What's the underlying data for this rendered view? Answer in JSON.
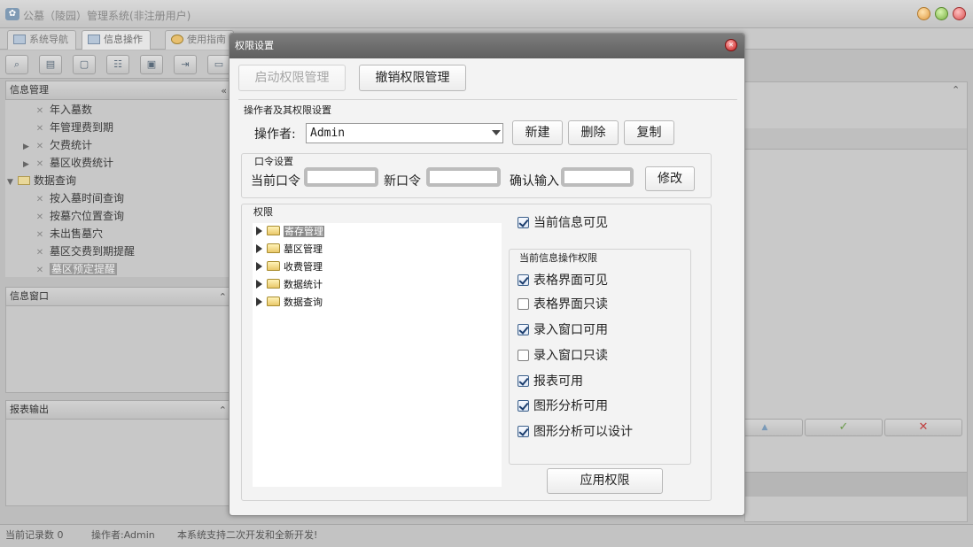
{
  "app": {
    "title": "公墓（陵园）管理系统(非注册用户)",
    "tabs": [
      {
        "label": "系统导航"
      },
      {
        "label": "信息操作"
      },
      {
        "label": "使用指南"
      }
    ]
  },
  "left_panel": {
    "header": "信息管理",
    "collapse_glyph": "«",
    "tree": [
      {
        "label": "年入墓数"
      },
      {
        "label": "年管理费到期"
      },
      {
        "label": "欠费统计"
      },
      {
        "label": "墓区收费统计"
      },
      {
        "label": "数据查询"
      },
      {
        "label": "按入墓时间查询"
      },
      {
        "label": "按墓穴位置查询"
      },
      {
        "label": "未出售墓穴"
      },
      {
        "label": "墓区交费到期提醒"
      },
      {
        "label": "墓区预定提醒"
      }
    ],
    "info_window_header": "信息窗口",
    "report_header": "报表输出",
    "expand_glyph": "⌃"
  },
  "right_area": {
    "up_glyph": "▲",
    "ok_glyph": "✓",
    "cancel_glyph": "✕"
  },
  "status": {
    "records": "当前记录数 0",
    "operator": "操作者:Admin",
    "notice": "本系统支持二次开发和全新开发!"
  },
  "dialog": {
    "title": "权限设置",
    "enable_button": "启动权限管理",
    "revoke_button": "撤销权限管理",
    "operator_group_label": "操作者及其权限设置",
    "operator_label": "操作者:",
    "operator_value": "Admin",
    "new_button": "新建",
    "delete_button": "删除",
    "copy_button": "复制",
    "password_group_label": "口令设置",
    "current_pwd_label": "当前口令",
    "new_pwd_label": "新口令",
    "confirm_pwd_label": "确认输入",
    "modify_button": "修改",
    "perm_group_label": "权限",
    "perm_tree": [
      {
        "label": "寄存管理",
        "selected": true
      },
      {
        "label": "墓区管理"
      },
      {
        "label": "收费管理"
      },
      {
        "label": "数据统计"
      },
      {
        "label": "数据查询"
      }
    ],
    "visible_checkbox": {
      "label": "当前信息可见",
      "checked": true
    },
    "ops_group_label": "当前信息操作权限",
    "ops": [
      {
        "label": "表格界面可见",
        "checked": true
      },
      {
        "label": "表格界面只读",
        "checked": false
      },
      {
        "label": "录入窗口可用",
        "checked": true
      },
      {
        "label": "录入窗口只读",
        "checked": false
      },
      {
        "label": "报表可用",
        "checked": true
      },
      {
        "label": "图形分析可用",
        "checked": true
      },
      {
        "label": "图形分析可以设计",
        "checked": true
      }
    ],
    "apply_button": "应用权限"
  }
}
